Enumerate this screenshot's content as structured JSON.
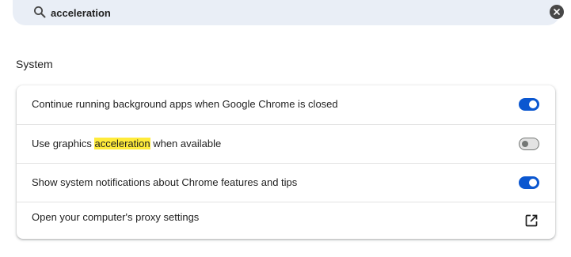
{
  "search": {
    "value": "acceleration",
    "icon": "search-icon",
    "clear_icon": "close-icon"
  },
  "section": {
    "title": "System"
  },
  "settings": [
    {
      "label": "Continue running background apps when Google Chrome is closed",
      "control": "toggle",
      "enabled": true
    },
    {
      "label_before": "Use graphics ",
      "label_highlight": "acceleration",
      "label_after": " when available",
      "control": "toggle",
      "enabled": false
    },
    {
      "label": "Show system notifications about Chrome features and tips",
      "control": "toggle",
      "enabled": true
    },
    {
      "label": "Open your computer's proxy settings",
      "control": "external-link",
      "icon": "open-in-new-icon"
    }
  ],
  "colors": {
    "accent": "#0b57d0",
    "search_background": "#e9eef6",
    "highlight": "#ffeb3b",
    "text": "#1f1f1f"
  }
}
